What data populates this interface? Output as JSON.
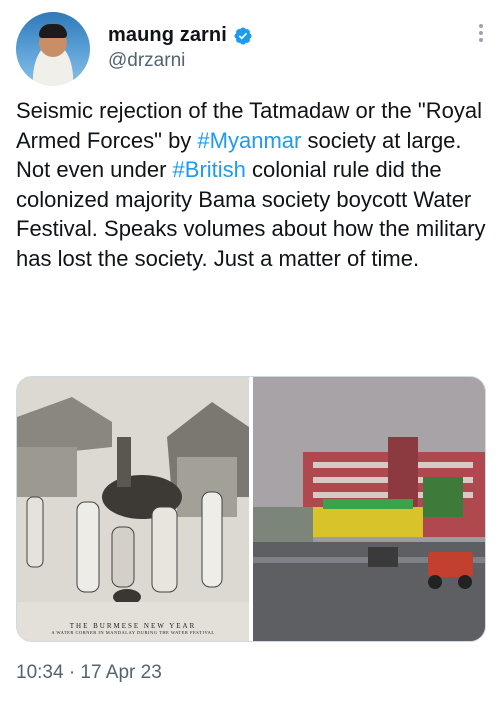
{
  "author": {
    "display_name": "maung zarni",
    "handle": "@drzarni",
    "verified": true,
    "avatar_icon": "profile-photo"
  },
  "tweet": {
    "segments": [
      {
        "text": "Seismic rejection of the Tatmadaw or the \"Royal Armed Forces\" by ",
        "hashtag": false
      },
      {
        "text": "#Myanmar",
        "hashtag": true
      },
      {
        "text": " society at large.  Not even under ",
        "hashtag": false
      },
      {
        "text": "#British",
        "hashtag": true
      },
      {
        "text": " colonial rule did the colonized majority Bama society boycott Water Festival.  Speaks volumes about how the military has lost the society. Just a matter of time.",
        "hashtag": false
      }
    ]
  },
  "media": {
    "left_caption_title": "THE BURMESE NEW YEAR",
    "left_caption_sub": "A WATER CORNER IN MANDALAY DURING THE WATER FESTIVAL"
  },
  "meta": {
    "timestamp": "10:34 · 17 Apr 23"
  },
  "colors": {
    "text": "#0f1419",
    "secondary": "#536471",
    "hashtag": "#1d9bf0",
    "verified": "#1d9bf0"
  }
}
